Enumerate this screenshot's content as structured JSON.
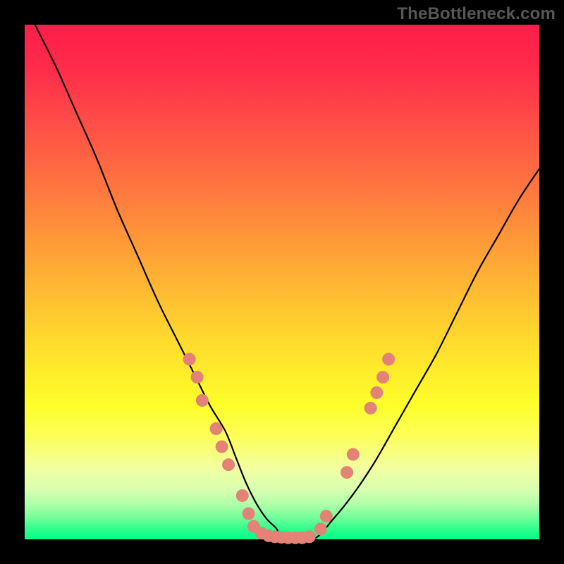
{
  "watermark": "TheBottleneck.com",
  "chart_data": {
    "type": "line",
    "title": "",
    "xlabel": "",
    "ylabel": "",
    "xlim": [
      0,
      100
    ],
    "ylim": [
      0,
      100
    ],
    "background_gradient": [
      "#ff1e4a",
      "#feff2a",
      "#00ff88"
    ],
    "series": [
      {
        "name": "curve",
        "x": [
          2,
          6,
          10,
          14,
          18,
          22,
          26,
          30,
          33,
          36,
          39,
          41,
          43,
          45,
          47,
          49,
          50,
          56,
          60,
          64,
          68,
          72,
          76,
          80,
          84,
          88,
          92,
          96,
          100
        ],
        "y": [
          100,
          92,
          83,
          74,
          64,
          55,
          46,
          38,
          32,
          26,
          21,
          16,
          11,
          7,
          4,
          2,
          0,
          0,
          4,
          9,
          15,
          22,
          29,
          36,
          44,
          52,
          59,
          66,
          72
        ],
        "color": "#000000",
        "note": "y is percent height from bottom; curve minimum (green zone) around x≈50"
      }
    ],
    "markers": {
      "name": "dots",
      "color": "#e38276",
      "radius": 9,
      "points": [
        {
          "x": 32.0,
          "y": 35.0
        },
        {
          "x": 33.5,
          "y": 31.5
        },
        {
          "x": 34.5,
          "y": 27.0
        },
        {
          "x": 37.2,
          "y": 21.5
        },
        {
          "x": 38.3,
          "y": 18.0
        },
        {
          "x": 39.6,
          "y": 14.5
        },
        {
          "x": 42.3,
          "y": 8.5
        },
        {
          "x": 43.5,
          "y": 5.0
        },
        {
          "x": 44.5,
          "y": 2.5
        },
        {
          "x": 46.0,
          "y": 1.2
        },
        {
          "x": 47.4,
          "y": 0.7
        },
        {
          "x": 48.6,
          "y": 0.5
        },
        {
          "x": 49.9,
          "y": 0.4
        },
        {
          "x": 51.2,
          "y": 0.3
        },
        {
          "x": 52.6,
          "y": 0.3
        },
        {
          "x": 53.9,
          "y": 0.3
        },
        {
          "x": 55.3,
          "y": 0.5
        },
        {
          "x": 57.5,
          "y": 2.0
        },
        {
          "x": 58.6,
          "y": 4.5
        },
        {
          "x": 62.6,
          "y": 13.0
        },
        {
          "x": 63.8,
          "y": 16.5
        },
        {
          "x": 67.2,
          "y": 25.5
        },
        {
          "x": 68.4,
          "y": 28.5
        },
        {
          "x": 69.6,
          "y": 31.5
        },
        {
          "x": 70.7,
          "y": 35.0
        }
      ]
    }
  }
}
